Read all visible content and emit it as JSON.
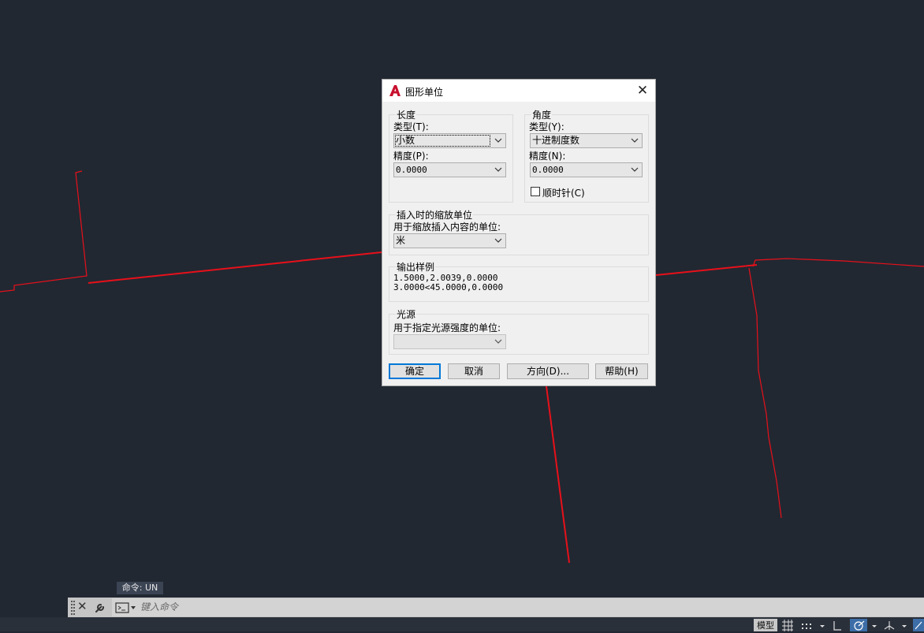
{
  "dialog": {
    "title": "图形单位",
    "length": {
      "group_title": "长度",
      "type_label": "类型(T):",
      "type_value": "小数",
      "precision_label": "精度(P):",
      "precision_value": "0.0000"
    },
    "angle": {
      "group_title": "角度",
      "type_label": "类型(Y):",
      "type_value": "十进制度数",
      "precision_label": "精度(N):",
      "precision_value": "0.0000",
      "clockwise_label": "顺时针(C)",
      "clockwise_checked": false
    },
    "insert": {
      "group_title": "插入时的缩放单位",
      "label": "用于缩放插入内容的单位:",
      "value": "米"
    },
    "sample": {
      "group_title": "输出样例",
      "line1": "1.5000,2.0039,0.0000",
      "line2": "3.0000<45.0000,0.0000"
    },
    "lighting": {
      "group_title": "光源",
      "label": "用于指定光源强度的单位:",
      "value": ""
    },
    "buttons": {
      "ok": "确定",
      "cancel": "取消",
      "direction": "方向(D)...",
      "help": "帮助(H)"
    }
  },
  "command": {
    "tooltip": "命令: UN",
    "placeholder": "键入命令"
  },
  "status": {
    "model_tab": "模型"
  },
  "colors": {
    "background": "#212832",
    "lines": "#e8101a",
    "accent": "#0078d7",
    "annotation_stroke": "#e8101a"
  }
}
